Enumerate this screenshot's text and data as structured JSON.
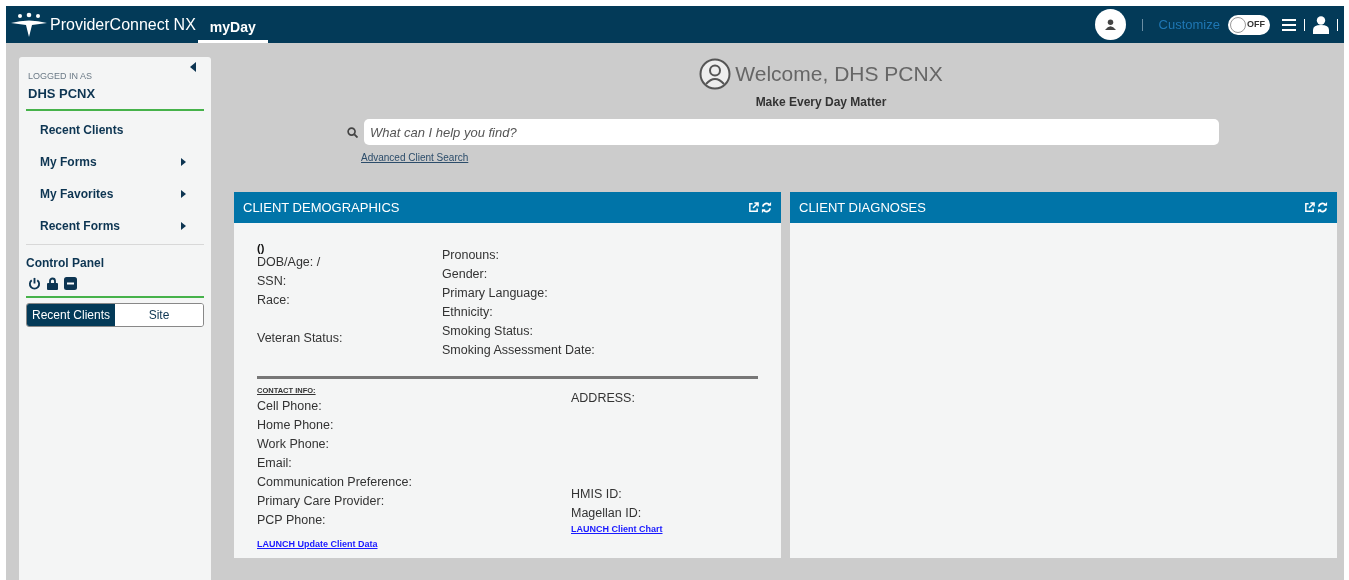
{
  "header": {
    "brand": "ProviderConnect NX",
    "tabs": [
      {
        "label": "myDay",
        "selected": true
      }
    ],
    "customize": {
      "label": "Customize",
      "toggle_label": "OFF",
      "on": false
    }
  },
  "sidebar": {
    "logged_in_label": "LOGGED IN AS",
    "user": "DHS PCNX",
    "items": [
      {
        "label": "Recent Clients",
        "has_submenu": false
      },
      {
        "label": "My Forms",
        "has_submenu": true
      },
      {
        "label": "My Favorites",
        "has_submenu": true
      },
      {
        "label": "Recent Forms",
        "has_submenu": true
      }
    ],
    "control_panel": "Control Panel",
    "segments": [
      {
        "label": "Recent Clients",
        "selected": true
      },
      {
        "label": "Site",
        "selected": false
      }
    ]
  },
  "welcome": {
    "title": "Welcome, DHS PCNX",
    "subtitle": "Make Every Day Matter",
    "search": {
      "placeholder": "What can I help you find?"
    },
    "advanced_link": "Advanced Client Search"
  },
  "demographics": {
    "title": "CLIENT DEMOGRAPHICS",
    "name": "()",
    "left": [
      "DOB/Age: /",
      "SSN:",
      "Race:"
    ],
    "veteran": "Veteran Status:",
    "right": [
      "Pronouns:",
      "Gender:",
      "Primary Language:",
      "Ethnicity:",
      "Smoking Status:",
      "Smoking Assessment Date:"
    ],
    "contact_heading": "CONTACT INFO:",
    "contact": [
      "Cell Phone:",
      "Home Phone:",
      "Work Phone:",
      "Email:",
      "Communication Preference:",
      "Primary Care Provider:",
      "PCP Phone:"
    ],
    "address": "ADDRESS:",
    "ids": [
      "HMIS ID:",
      "Magellan ID:"
    ],
    "launch_left": "LAUNCH Update Client Data",
    "launch_right": "LAUNCH Client Chart"
  },
  "diagnoses": {
    "title": "CLIENT DIAGNOSES"
  }
}
